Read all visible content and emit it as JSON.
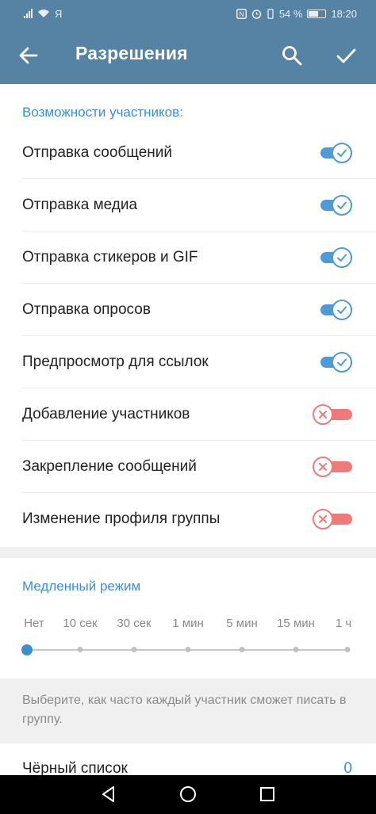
{
  "status_bar": {
    "carrier_glyph": "Я",
    "battery": "54 %",
    "time": "18:20",
    "icons": [
      "signal-icon",
      "wifi-icon",
      "nfc-icon",
      "alarm-icon",
      "vibrate-icon",
      "battery-icon"
    ]
  },
  "app_bar": {
    "title": "Разрешения",
    "icons": [
      "back-arrow-icon",
      "search-icon",
      "checkmark-icon"
    ]
  },
  "permissions": {
    "header": "Возможности участников:",
    "items": [
      {
        "label": "Отправка сообщений",
        "enabled": true
      },
      {
        "label": "Отправка медиа",
        "enabled": true
      },
      {
        "label": "Отправка стикеров и GIF",
        "enabled": true
      },
      {
        "label": "Отправка опросов",
        "enabled": true
      },
      {
        "label": "Предпросмотр для ссылок",
        "enabled": true
      },
      {
        "label": "Добавление участников",
        "enabled": false
      },
      {
        "label": "Закрепление сообщений",
        "enabled": false
      },
      {
        "label": "Изменение профиля группы",
        "enabled": false
      }
    ]
  },
  "slow_mode": {
    "header": "Медленный режим",
    "options": [
      "Нет",
      "10 сек",
      "30 сек",
      "1 мин",
      "5 мин",
      "15 мин",
      "1 ч"
    ],
    "selected": "Нет",
    "hint": "Выберите, как часто каждый участник сможет писать в группу."
  },
  "blacklist": {
    "label": "Чёрный список",
    "count": "0"
  },
  "colors": {
    "header_bg": "#5682a3",
    "accent": "#3b8ed0",
    "toggle_on": "#4f9ad9",
    "toggle_off": "#ef7a7a"
  }
}
